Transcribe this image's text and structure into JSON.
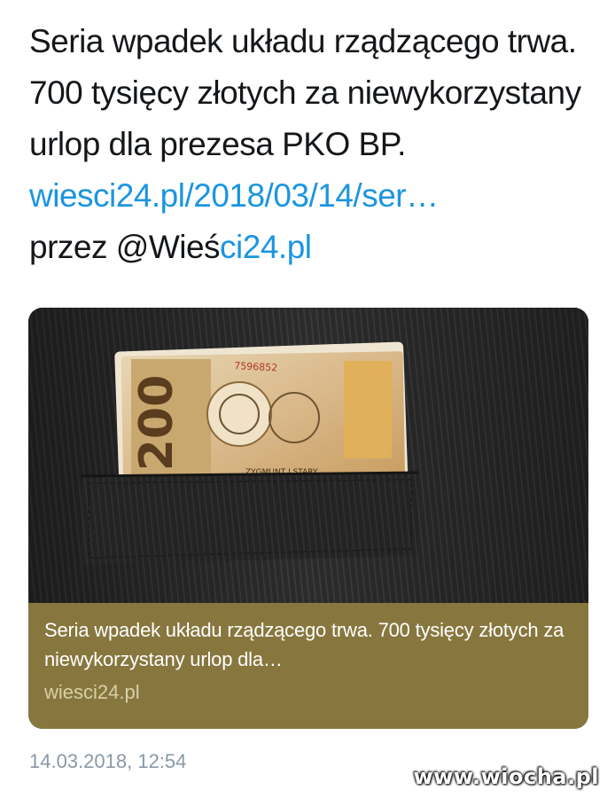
{
  "tweet": {
    "text_main": "Seria wpadek układu rządzącego trwa. 700 tysięcy złotych za niewykorzystany urlop dla prezesa PKO BP.",
    "link_text": "wiesci24.pl/2018/03/14/ser…",
    "via_prefix": "przez @Wieś",
    "via_link": "ci24.pl",
    "timestamp": "14.03.2018, 12:54"
  },
  "card": {
    "title": "Seria wpadek układu rządzącego trwa. 700 tysięcy złotych za niewykorzystany urlop dla…",
    "domain": "wiesci24.pl",
    "banknote_value": "200",
    "banknote_caption": "ZYGMUNT I STARY",
    "banknote_serial": "7596852"
  },
  "watermark": {
    "text": "www.wiocha.pl"
  },
  "colors": {
    "link": "#1b95e0",
    "card_footer": "#87773e",
    "timestamp": "#8899a6"
  }
}
